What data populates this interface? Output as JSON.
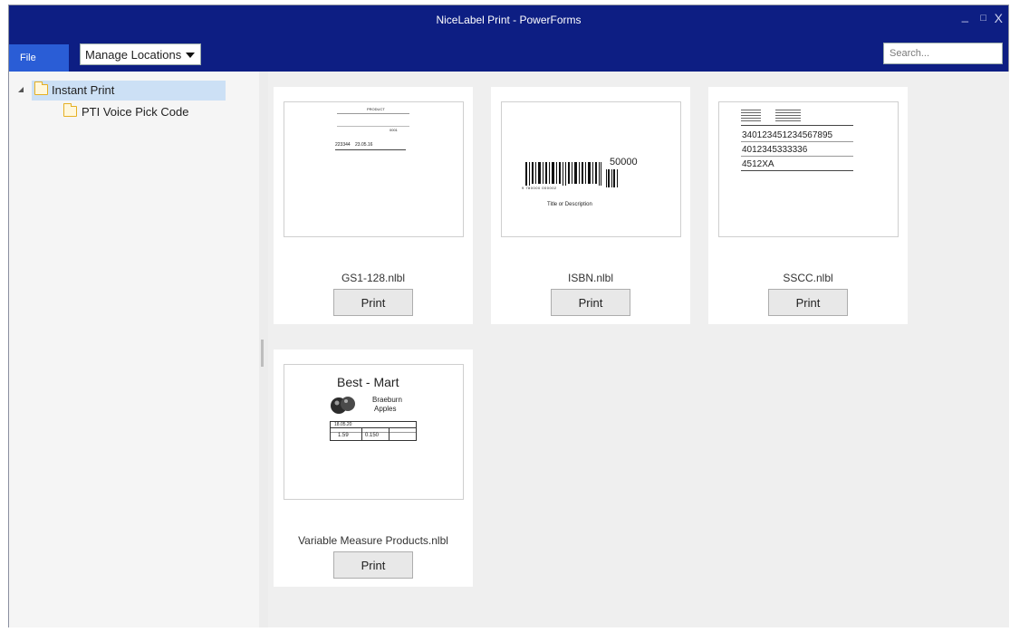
{
  "window": {
    "title": "NiceLabel Print - PowerForms",
    "controls": {
      "minimize": "_",
      "maximize": "□",
      "close": "X"
    }
  },
  "menubar": {
    "file_label": "File",
    "locations_label": "Manage Locations",
    "search_placeholder": "Search..."
  },
  "tree": {
    "items": [
      {
        "label": "Instant Print",
        "selected": true,
        "expanded": true,
        "icon": "folder-icon"
      },
      {
        "label": "PTI Voice Pick Code",
        "selected": false,
        "icon": "folder-icon"
      }
    ]
  },
  "labels": [
    {
      "file": "GS1-128.nlbl",
      "print_label": "Print",
      "preview": {
        "heading": "PRODUCT",
        "code1": "223344",
        "code2": "23.05.16",
        "number": "0001"
      }
    },
    {
      "file": "ISBN.nlbl",
      "print_label": "Print",
      "preview": {
        "price": "50000",
        "barcode_digits": "9 780000 000002",
        "caption": "Title or Description"
      }
    },
    {
      "file": "SSCC.nlbl",
      "print_label": "Print",
      "preview": {
        "line1": "340123451234567895",
        "line2": "4012345333336",
        "line3": "4512XA"
      }
    },
    {
      "file": "Variable Measure Products.nlbl",
      "print_label": "Print",
      "preview": {
        "store": "Best - Mart",
        "product_line1": "Braeburn",
        "product_line2": "Apples",
        "date": "18.05.20",
        "price": "1.59",
        "weight": "0.150"
      }
    }
  ],
  "colors": {
    "titlebar": "#0d1e83",
    "file_button": "#2a5dd6",
    "selected_tree_item": "#cce0f5",
    "folder": "#e6b022"
  }
}
